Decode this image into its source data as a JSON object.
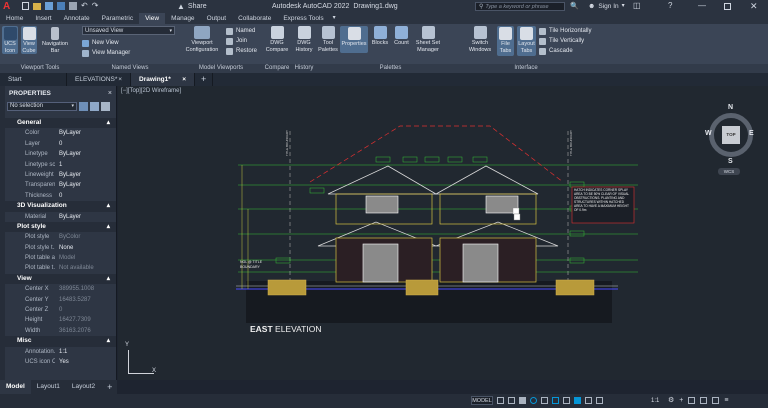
{
  "app": {
    "title": "Autodesk AutoCAD 2022",
    "filename": "Drawing1.dwg",
    "share_label": "Share",
    "search_placeholder": "Type a keyword or phrase",
    "sign_in": "Sign In"
  },
  "ribbon_tabs": [
    "Home",
    "Insert",
    "Annotate",
    "Parametric",
    "View",
    "Manage",
    "Output",
    "Collaborate",
    "Express Tools"
  ],
  "active_tab": "View",
  "ribbon": {
    "viewport_tools": {
      "title": "Viewport Tools",
      "ucs_icon": "UCS Icon",
      "view_cube": "View Cube",
      "navigation_bar": "Navigation Bar"
    },
    "named_views": {
      "title": "Named Views",
      "dropdown": "Unsaved View",
      "new_view": "New View",
      "view_manager": "View Manager"
    },
    "model_viewports": {
      "title": "Model Viewports",
      "viewport_configuration": "Viewport Configuration",
      "named": "Named",
      "join": "Join",
      "restore": "Restore"
    },
    "compare": {
      "title": "Compare",
      "dwg_compare": "DWG Compare"
    },
    "history": {
      "title": "History",
      "dwg_history": "DWG History"
    },
    "palettes": {
      "title": "Palettes",
      "tool_palettes": "Tool Palettes",
      "properties": "Properties",
      "blocks": "Blocks",
      "count": "Count",
      "sheet_set_manager": "Sheet Set Manager"
    },
    "interface": {
      "title": "Interface",
      "switch_windows": "Switch Windows",
      "file_tabs": "File Tabs",
      "layout_tabs": "Layout Tabs",
      "tile_horizontally": "Tile Horizontally",
      "tile_vertically": "Tile Vertically",
      "cascade": "Cascade"
    }
  },
  "doc_tabs": [
    "Start",
    "ELEVATIONS*",
    "Drawing1*"
  ],
  "active_doc_tab": "Drawing1*",
  "viewport_label": "[−][Top][2D Wireframe]",
  "properties": {
    "title": "PROPERTIES",
    "selection": "No selection",
    "sections": [
      {
        "name": "General",
        "rows": [
          {
            "k": "Color",
            "v": "ByLayer"
          },
          {
            "k": "Layer",
            "v": "0"
          },
          {
            "k": "Linetype",
            "v": "ByLayer"
          },
          {
            "k": "Linetype sc...",
            "v": "1"
          },
          {
            "k": "Lineweight",
            "v": "ByLayer"
          },
          {
            "k": "Transparency",
            "v": "ByLayer"
          },
          {
            "k": "Thickness",
            "v": "0"
          }
        ]
      },
      {
        "name": "3D Visualization",
        "rows": [
          {
            "k": "Material",
            "v": "ByLayer"
          }
        ]
      },
      {
        "name": "Plot style",
        "rows": [
          {
            "k": "Plot style",
            "v": "ByColor",
            "dim": true
          },
          {
            "k": "Plot style t...",
            "v": "None"
          },
          {
            "k": "Plot table a...",
            "v": "Model",
            "dim": true
          },
          {
            "k": "Plot table t...",
            "v": "Not available",
            "dim": true
          }
        ]
      },
      {
        "name": "View",
        "rows": [
          {
            "k": "Center X",
            "v": "389955.1008",
            "dim": true
          },
          {
            "k": "Center Y",
            "v": "16483.5287",
            "dim": true
          },
          {
            "k": "Center Z",
            "v": "0",
            "dim": true
          },
          {
            "k": "Height",
            "v": "16427.7309",
            "dim": true
          },
          {
            "k": "Width",
            "v": "36163.2076",
            "dim": true
          }
        ]
      },
      {
        "name": "Misc",
        "rows": [
          {
            "k": "Annotation...",
            "v": "1:1"
          },
          {
            "k": "UCS icon On",
            "v": "Yes"
          }
        ]
      }
    ]
  },
  "viewcube": {
    "north": "N",
    "south": "S",
    "east": "E",
    "west": "W",
    "face": "TOP",
    "wcs": "WCS"
  },
  "drawing": {
    "caption_bold": "EAST",
    "caption_rest": " ELEVATION",
    "note": "HATCH INDICATES CORNER SPLAY AREA TO BE 50% CLEAR OF VISUAL OBSTRUCTIONS. PLANTING AND STRUCTURES WITHIN HATCHED AREA TO HAVE A MAXIMUM HEIGHT OF 0.9m",
    "ngl_label": "NGL @ TITLE BOUNDARY",
    "boundary_label": "TITLE BOUNDARY"
  },
  "layout_tabs": [
    "Model",
    "Layout1",
    "Layout2"
  ],
  "active_layout": "Model",
  "status": {
    "model": "MODEL",
    "scale": "1:1"
  },
  "colors": {
    "accent": "#0696d7",
    "canvas": "#212830",
    "panel": "#2e3644"
  }
}
